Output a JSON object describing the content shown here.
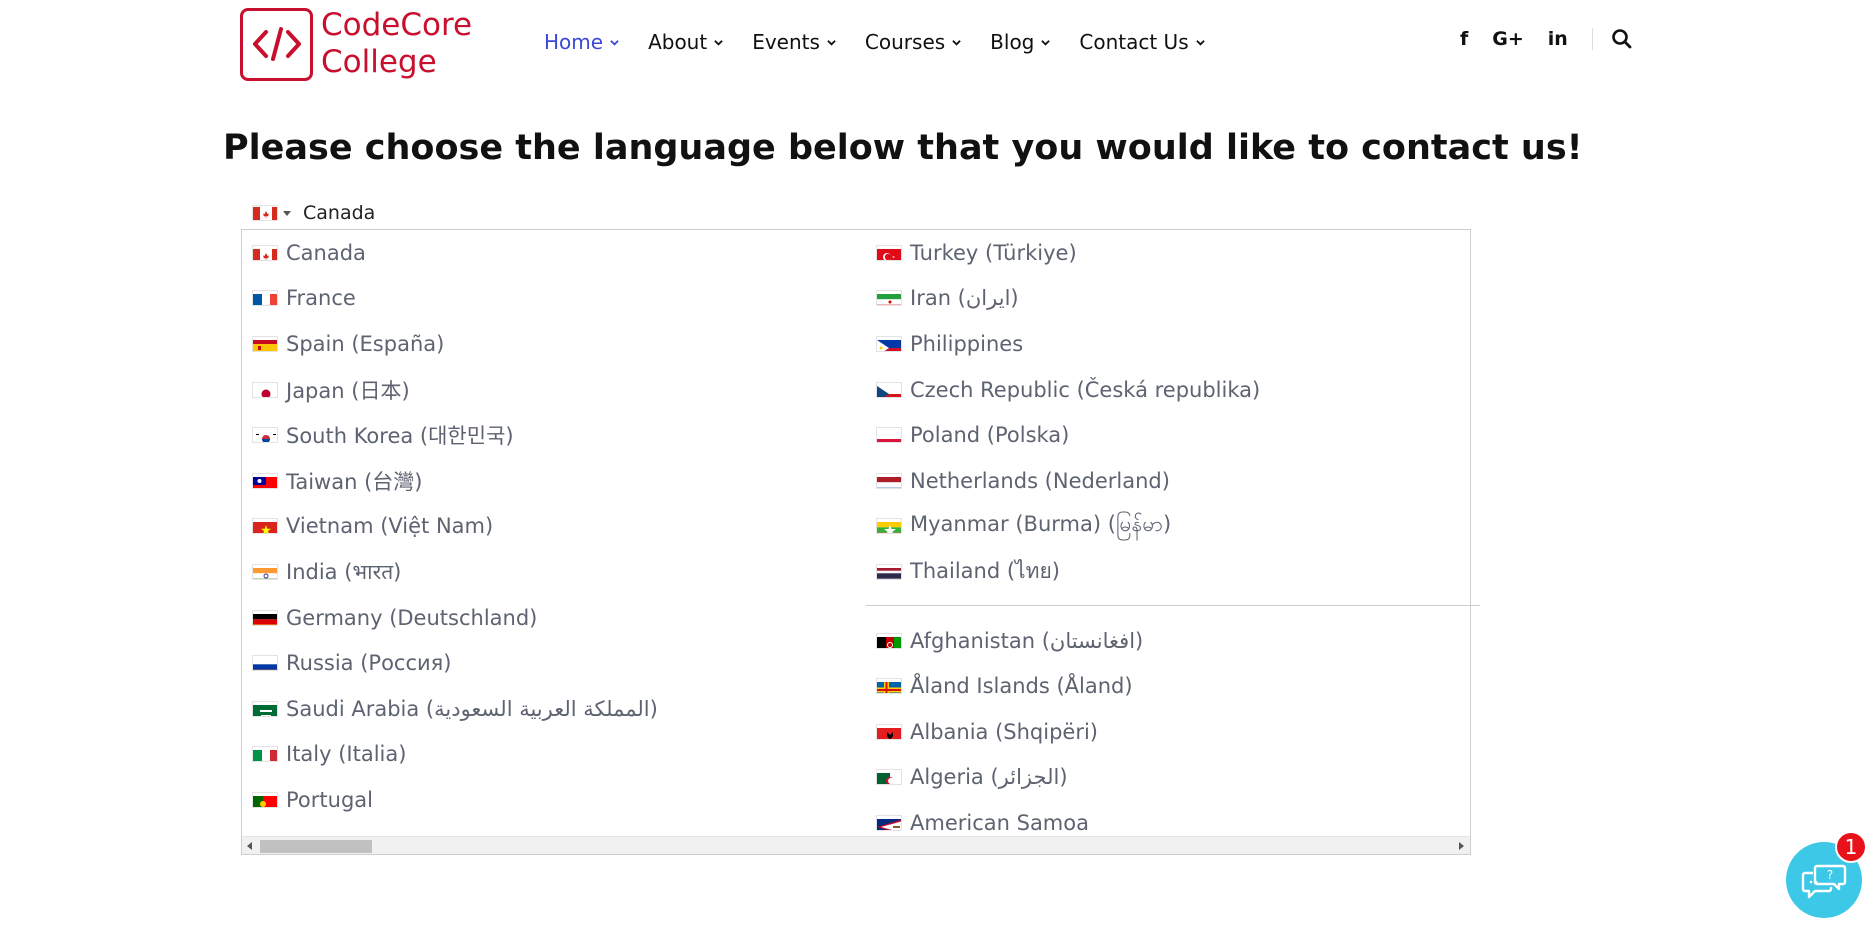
{
  "logo": {
    "line1": "CodeCore",
    "line2": "College",
    "color": "#c8102e"
  },
  "nav": {
    "items": [
      {
        "label": "Home",
        "active": true
      },
      {
        "label": "About",
        "active": false
      },
      {
        "label": "Events",
        "active": false
      },
      {
        "label": "Courses",
        "active": false
      },
      {
        "label": "Blog",
        "active": false
      },
      {
        "label": "Contact Us",
        "active": false
      }
    ],
    "active_color": "#3b48d6"
  },
  "social": {
    "facebook": "f",
    "googleplus": "G+",
    "linkedin": "in"
  },
  "main": {
    "title": "Please choose the language below that you would like to contact us!"
  },
  "selector": {
    "selected": "Canada"
  },
  "dropdown": {
    "left": [
      "Canada",
      "France",
      "Spain (España)",
      "Japan (日本)",
      "South Korea (대한민국)",
      "Taiwan (台灣)",
      "Vietnam (Việt Nam)",
      "India (भारत)",
      "Germany (Deutschland)",
      "Russia (Россия)",
      "Saudi Arabia (المملكة العربية السعودية)",
      "Italy (Italia)",
      "Portugal"
    ],
    "right_preferred": [
      "Turkey (Türkiye)",
      "Iran (ایران)",
      "Philippines",
      "Czech Republic (Česká republika)",
      "Poland (Polska)",
      "Netherlands (Nederland)",
      "Myanmar (Burma) (မြန်မာ)",
      "Thailand (ไทย)"
    ],
    "right_all": [
      "Afghanistan (افغانستان)",
      "Åland Islands (Åland)",
      "Albania (Shqipëri)",
      "Algeria (الجزائر)",
      "American Samoa"
    ]
  },
  "chat": {
    "badge_count": "1",
    "bg": "#3cc8e6"
  }
}
